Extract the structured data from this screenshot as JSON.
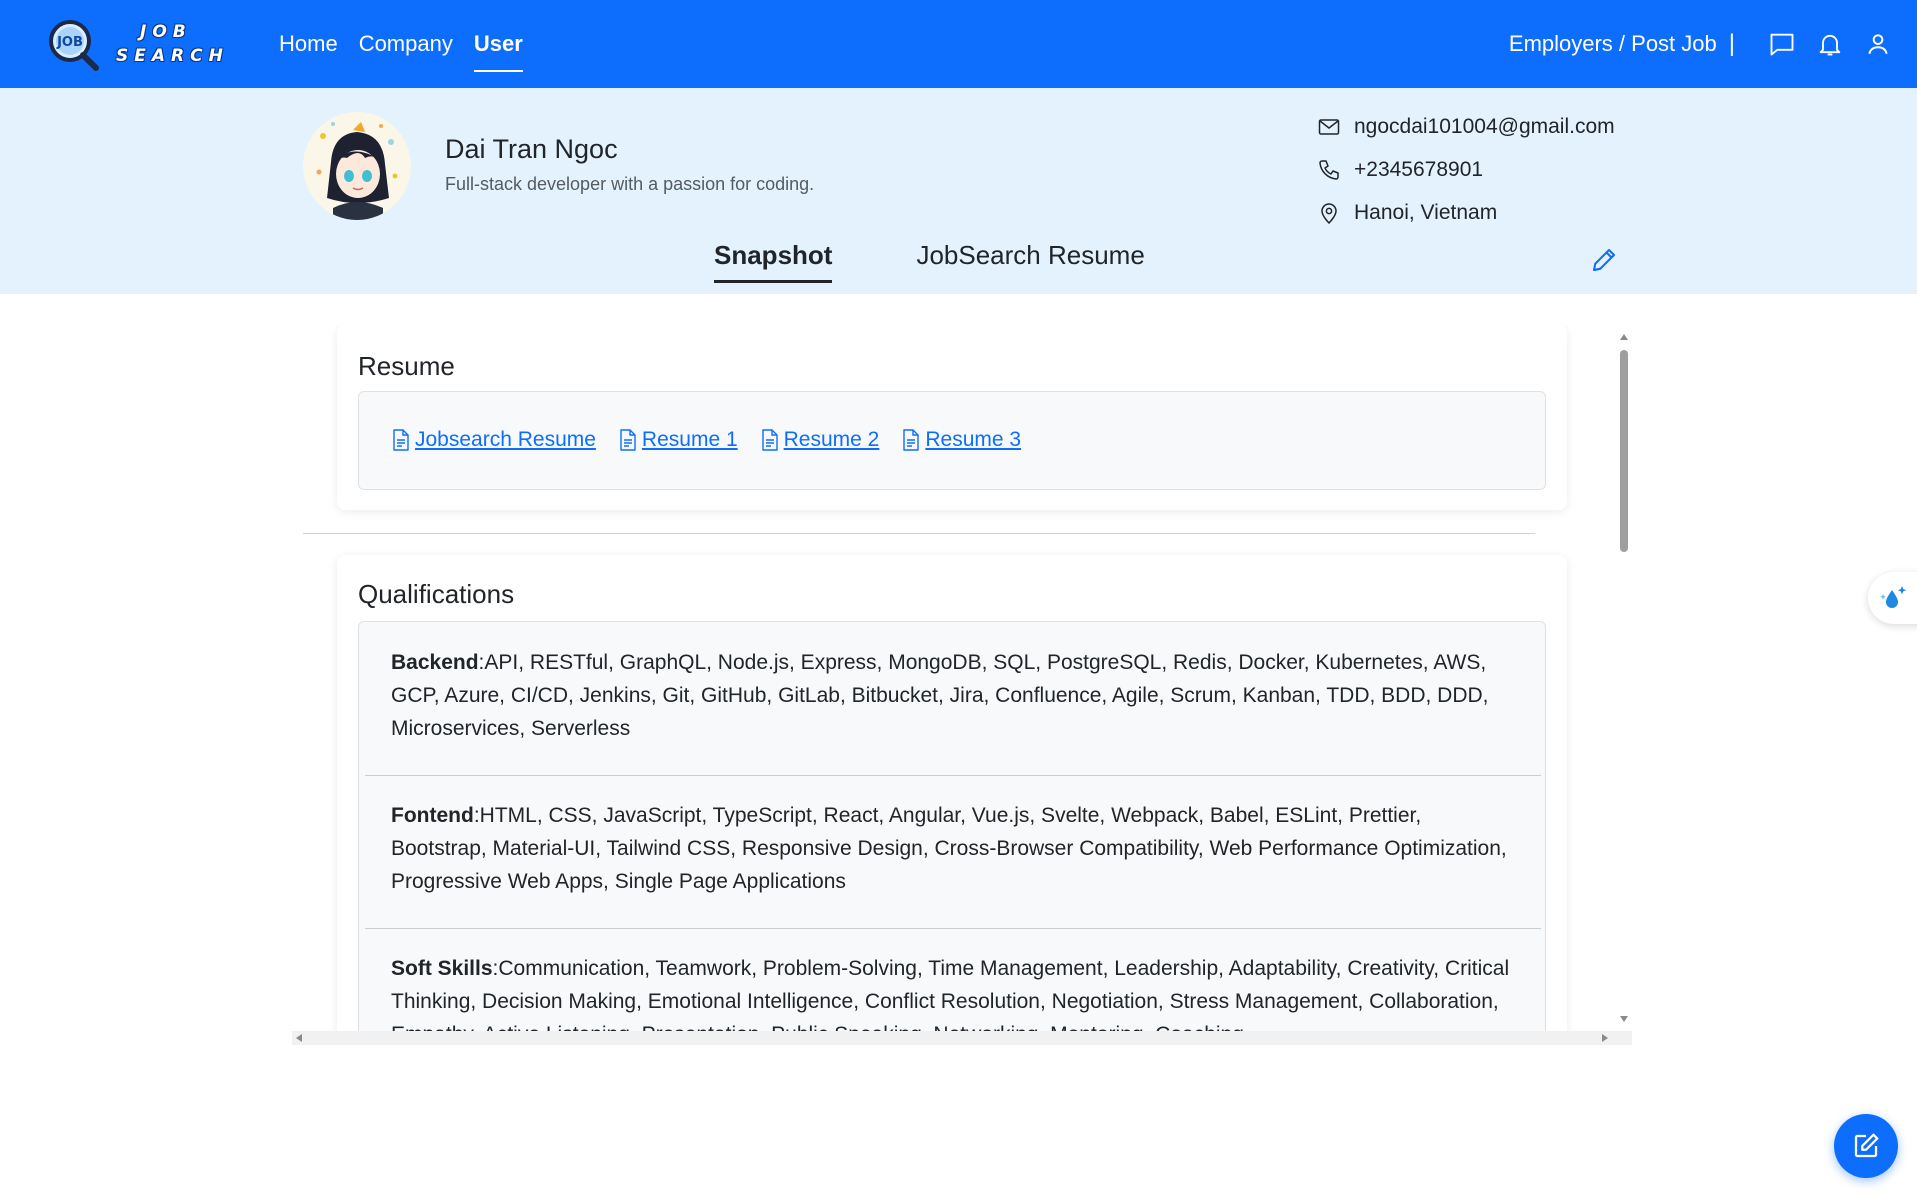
{
  "navbar": {
    "logo_line1": "JOB",
    "logo_line2": "SEARCH",
    "logo_badge": "JOB",
    "links": [
      {
        "label": "Home",
        "active": false
      },
      {
        "label": "Company",
        "active": false
      },
      {
        "label": "User",
        "active": true
      }
    ],
    "employers_label": "Employers / Post Job",
    "separator": "|",
    "icons": [
      "message-icon",
      "bell-icon",
      "user-icon"
    ]
  },
  "profile": {
    "name": "Dai Tran Ngoc",
    "bio": "Full-stack developer with a passion for coding.",
    "email": "ngocdai101004@gmail.com",
    "phone": "+2345678901",
    "location": "Hanoi, Vietnam"
  },
  "tabs": [
    {
      "label": "Snapshot",
      "active": true
    },
    {
      "label": "JobSearch Resume",
      "active": false
    }
  ],
  "resume_card": {
    "title": "Resume",
    "links": [
      "Jobsearch Resume",
      "Resume 1",
      "Resume 2",
      "Resume 3"
    ]
  },
  "qualifications_card": {
    "title": "Qualifications",
    "items": [
      {
        "label": "Backend",
        "separator": ":",
        "text": "API, RESTful, GraphQL, Node.js, Express, MongoDB, SQL, PostgreSQL, Redis, Docker, Kubernetes, AWS, GCP, Azure, CI/CD, Jenkins, Git, GitHub, GitLab, Bitbucket, Jira, Confluence, Agile, Scrum, Kanban, TDD, BDD, DDD, Microservices, Serverless"
      },
      {
        "label": "Fontend",
        "separator": ":",
        "text": "HTML, CSS, JavaScript, TypeScript, React, Angular, Vue.js, Svelte, Webpack, Babel, ESLint, Prettier, Bootstrap, Material-UI, Tailwind CSS, Responsive Design, Cross-Browser Compatibility, Web Performance Optimization, Progressive Web Apps, Single Page Applications"
      },
      {
        "label": "Soft Skills",
        "separator": ":",
        "text": "Communication, Teamwork, Problem-Solving, Time Management, Leadership, Adaptability, Creativity, Critical Thinking, Decision Making, Emotional Intelligence, Conflict Resolution, Negotiation, Stress Management, Collaboration, Empathy, Active Listening, Presentation, Public Speaking, Networking, Mentoring, Coaching"
      }
    ]
  },
  "colors": {
    "primary": "#0d6efd",
    "header_band": "#e3f2fd",
    "card_inner": "#f8f9fa"
  }
}
